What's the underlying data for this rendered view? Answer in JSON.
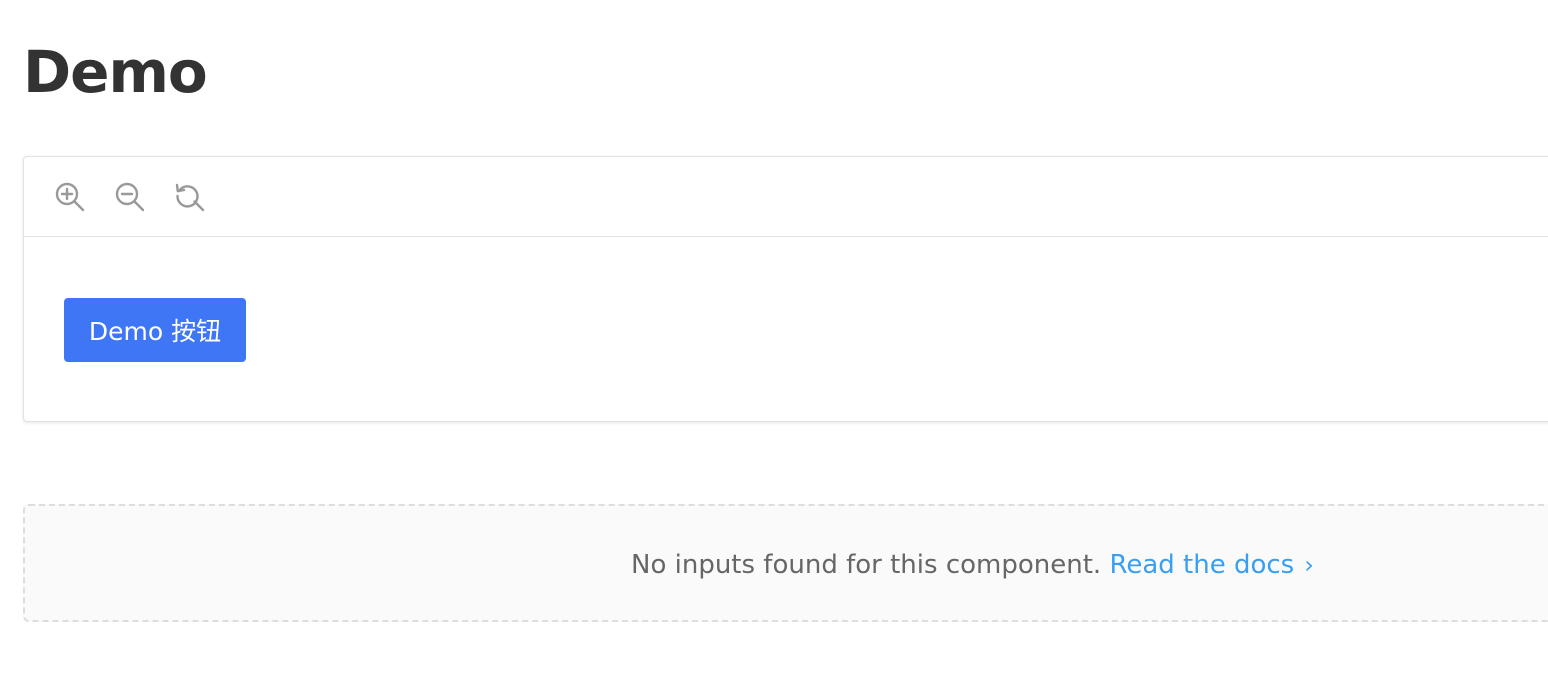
{
  "page": {
    "title": "Demo"
  },
  "toolbar": {
    "zoom_in_icon": "zoom-in-icon",
    "zoom_out_icon": "zoom-out-icon",
    "reset_zoom_icon": "reset-zoom-icon",
    "icon_color": "#999999"
  },
  "preview": {
    "button_label": "Demo 按钮",
    "button_color": "#3e76f6"
  },
  "inputs_panel": {
    "message": "No inputs found for this component. ",
    "link_label": "Read the docs",
    "chevron": "›",
    "link_color": "#3a9ff0"
  }
}
